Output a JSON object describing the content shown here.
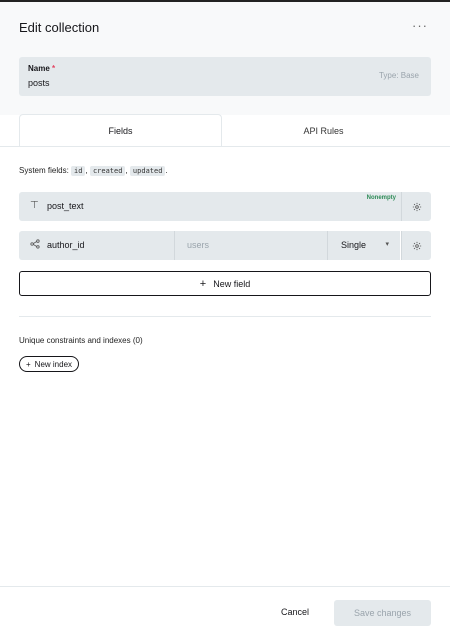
{
  "header": {
    "title": "Edit collection",
    "more_label": "···"
  },
  "name_field": {
    "label": "Name",
    "required_mark": "*",
    "value": "posts",
    "type_badge": "Type: Base"
  },
  "tabs": [
    {
      "label": "Fields",
      "active": true
    },
    {
      "label": "API Rules",
      "active": false
    }
  ],
  "system_fields": {
    "prefix": "System fields:",
    "items": [
      "id",
      "created",
      "updated"
    ],
    "sep": ",",
    "end": "."
  },
  "fields": [
    {
      "icon": "text-icon",
      "name": "post_text",
      "badge": "Nonempty"
    },
    {
      "icon": "relation-icon",
      "name": "author_id",
      "relation": "users",
      "mode": "Single"
    }
  ],
  "new_field_label": "New field",
  "unique": {
    "title": "Unique constraints and indexes (0)",
    "new_index_label": "New index"
  },
  "footer": {
    "cancel_label": "Cancel",
    "save_label": "Save changes"
  },
  "colors": {
    "field_bg": "#e4e9ec",
    "accent_green": "#2e8b57",
    "required_red": "#e34562"
  }
}
